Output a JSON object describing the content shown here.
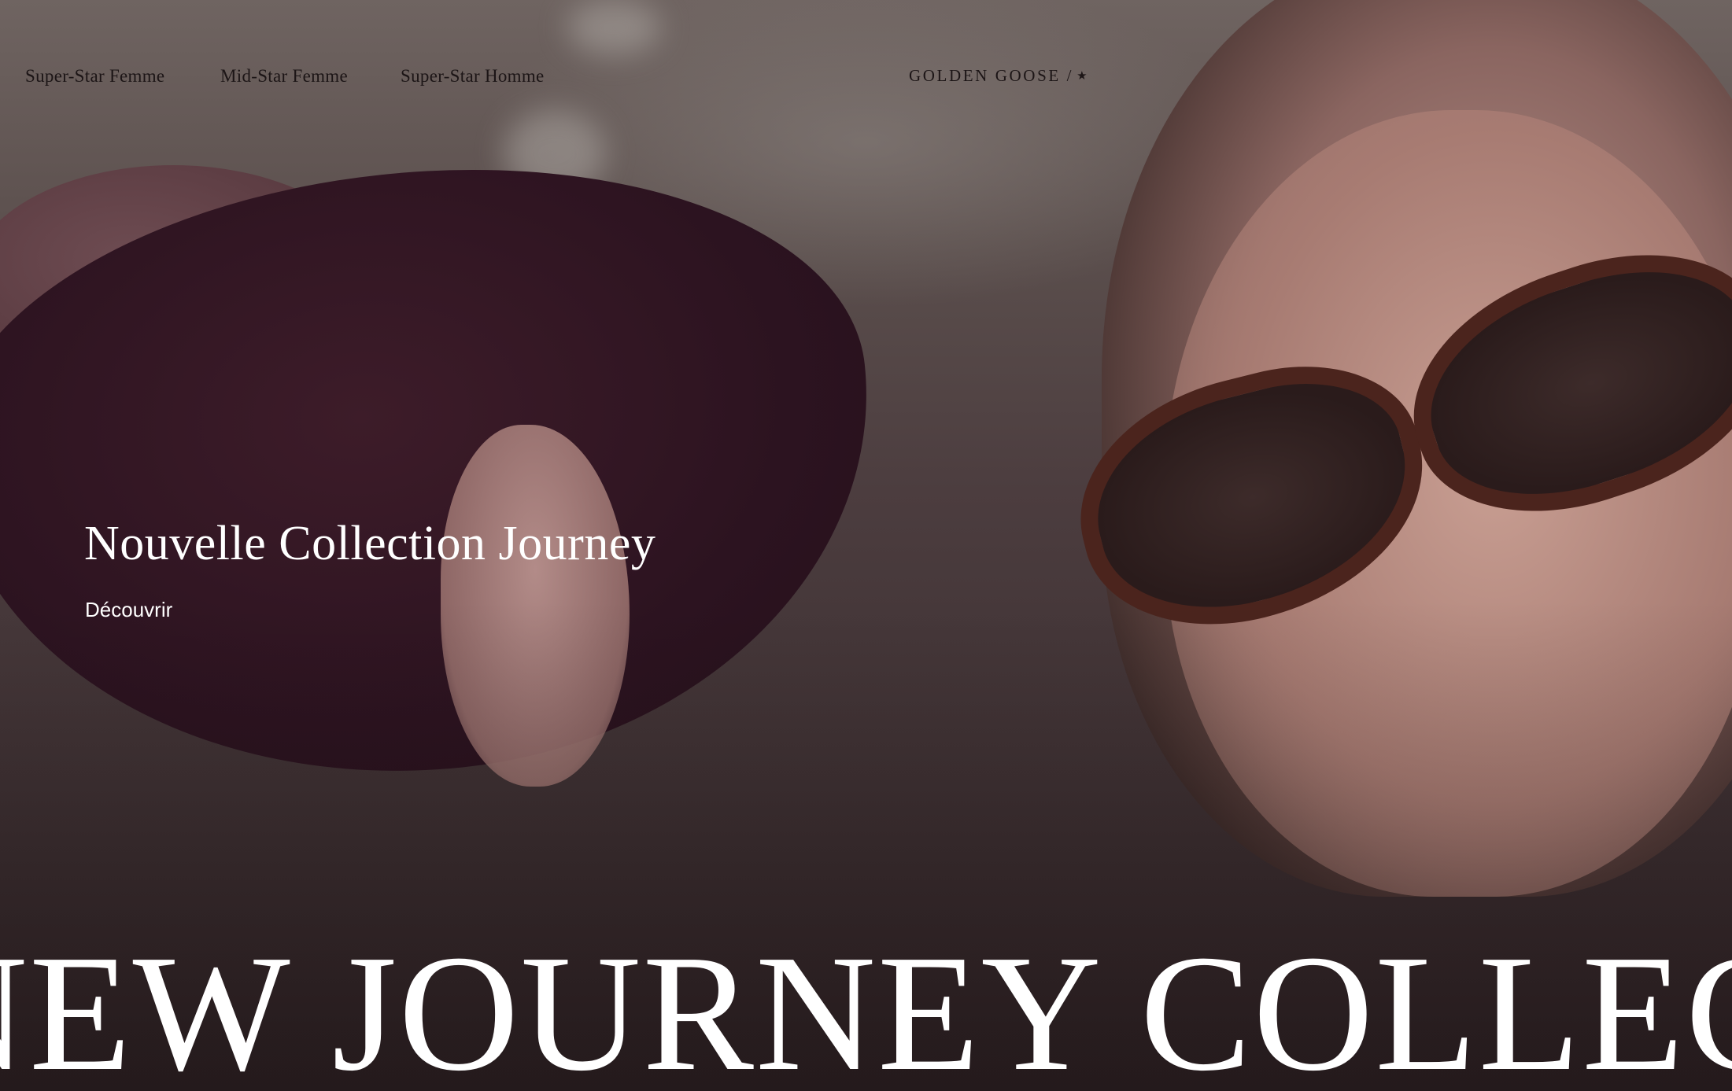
{
  "nav": {
    "links": [
      {
        "label": "Super-Star Femme"
      },
      {
        "label": "Mid-Star Femme"
      },
      {
        "label": "Super-Star Homme"
      }
    ],
    "brand": {
      "label": "GOLDEN GOOSE /",
      "star_icon": "★"
    }
  },
  "hero": {
    "title": "Nouvelle Collection Journey",
    "cta": "Découvrir",
    "background_image": "hero-photo"
  },
  "marquee": {
    "text": "NEW JOURNEY COLLECTION"
  },
  "colors": {
    "nav_text": "#1c1516",
    "hero_text": "#ffffff"
  }
}
